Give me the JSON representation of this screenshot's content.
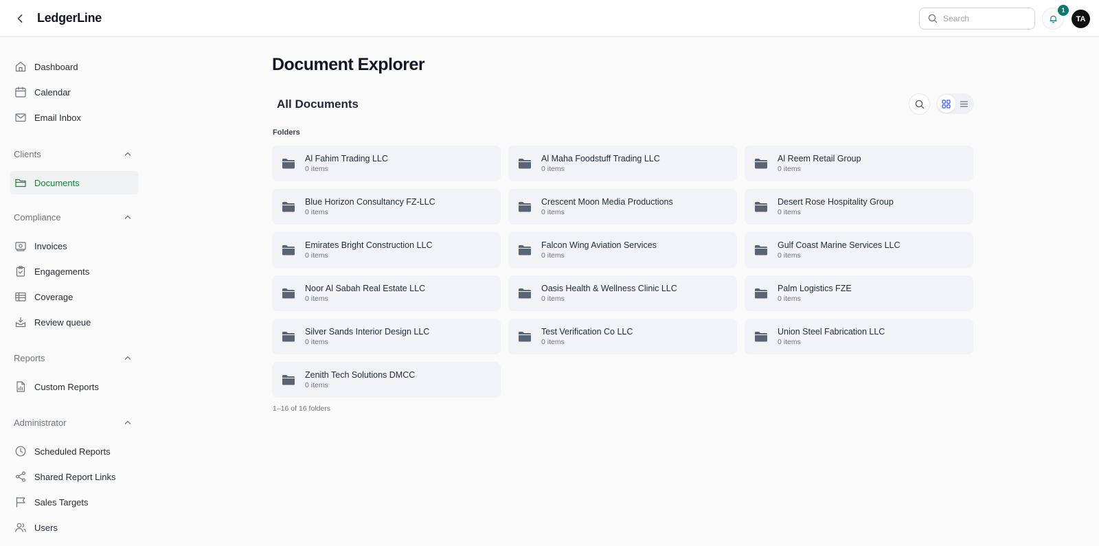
{
  "app": {
    "name": "LedgerLine"
  },
  "header": {
    "search_placeholder": "Search",
    "notification_count": "1",
    "avatar_initials": "TA"
  },
  "sidebar": {
    "top_items": [
      {
        "label": "Dashboard",
        "icon": "home-icon"
      },
      {
        "label": "Calendar",
        "icon": "calendar-icon"
      },
      {
        "label": "Email Inbox",
        "icon": "mail-icon"
      }
    ],
    "sections": [
      {
        "title": "Clients",
        "items": [
          {
            "label": "Documents",
            "icon": "folder-icon",
            "active": true
          }
        ]
      },
      {
        "title": "Compliance",
        "items": [
          {
            "label": "Invoices",
            "icon": "invoice-icon"
          },
          {
            "label": "Engagements",
            "icon": "clipboard-icon"
          },
          {
            "label": "Coverage",
            "icon": "table-icon"
          },
          {
            "label": "Review queue",
            "icon": "inbox-download-icon"
          }
        ]
      },
      {
        "title": "Reports",
        "items": [
          {
            "label": "Custom Reports",
            "icon": "file-chart-icon"
          }
        ]
      },
      {
        "title": "Administrator",
        "items": [
          {
            "label": "Scheduled Reports",
            "icon": "clock-icon"
          },
          {
            "label": "Shared Report Links",
            "icon": "share-icon"
          },
          {
            "label": "Sales Targets",
            "icon": "flag-icon"
          },
          {
            "label": "Users",
            "icon": "users-icon"
          }
        ]
      }
    ]
  },
  "main": {
    "page_title": "Document Explorer",
    "section_title": "All Documents",
    "folders_label": "Folders",
    "view_mode": "grid",
    "folders": [
      {
        "name": "Al Fahim Trading LLC",
        "count": "0 items"
      },
      {
        "name": "Al Maha Foodstuff Trading LLC",
        "count": "0 items"
      },
      {
        "name": "Al Reem Retail Group",
        "count": "0 items"
      },
      {
        "name": "Blue Horizon Consultancy FZ-LLC",
        "count": "0 items"
      },
      {
        "name": "Crescent Moon Media Productions",
        "count": "0 items"
      },
      {
        "name": "Desert Rose Hospitality Group",
        "count": "0 items"
      },
      {
        "name": "Emirates Bright Construction LLC",
        "count": "0 items"
      },
      {
        "name": "Falcon Wing Aviation Services",
        "count": "0 items"
      },
      {
        "name": "Gulf Coast Marine Services LLC",
        "count": "0 items"
      },
      {
        "name": "Noor Al Sabah Real Estate LLC",
        "count": "0 items"
      },
      {
        "name": "Oasis Health & Wellness Clinic LLC",
        "count": "0 items"
      },
      {
        "name": "Palm Logistics FZE",
        "count": "0 items"
      },
      {
        "name": "Silver Sands Interior Design LLC",
        "count": "0 items"
      },
      {
        "name": "Test Verification Co LLC",
        "count": "0 items"
      },
      {
        "name": "Union Steel Fabrication LLC",
        "count": "0 items"
      },
      {
        "name": "Zenith Tech Solutions DMCC",
        "count": "0 items"
      }
    ],
    "pagination": "1–16 of 16 folders"
  },
  "colors": {
    "accent": "#0f766e",
    "active_text": "#15803d",
    "folder_icon": "#5b6472"
  }
}
